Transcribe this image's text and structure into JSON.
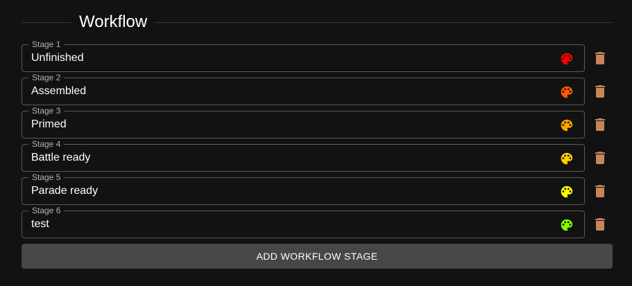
{
  "section": {
    "title": "Workflow"
  },
  "stages": [
    {
      "label": "Stage 1",
      "value": "Unfinished",
      "color": "#ff0000",
      "color_icon": "palette-icon",
      "delete_icon": "trash-icon"
    },
    {
      "label": "Stage 2",
      "value": "Assembled",
      "color": "#ff5a00",
      "color_icon": "palette-icon",
      "delete_icon": "trash-icon"
    },
    {
      "label": "Stage 3",
      "value": "Primed",
      "color": "#ffa500",
      "color_icon": "palette-icon",
      "delete_icon": "trash-icon"
    },
    {
      "label": "Stage 4",
      "value": "Battle ready",
      "color": "#ffd000",
      "color_icon": "palette-icon",
      "delete_icon": "trash-icon"
    },
    {
      "label": "Stage 5",
      "value": "Parade ready",
      "color": "#ffff00",
      "color_icon": "palette-icon",
      "delete_icon": "trash-icon"
    },
    {
      "label": "Stage 6",
      "value": "test",
      "color": "#7fff00",
      "color_icon": "palette-icon",
      "delete_icon": "trash-icon"
    }
  ],
  "actions": {
    "add_stage_label": "ADD WORKFLOW STAGE"
  },
  "colors": {
    "background": "#121212",
    "delete_icon": "#c8855a",
    "add_button_bg": "#474747",
    "field_border": "#5a5a5a"
  }
}
